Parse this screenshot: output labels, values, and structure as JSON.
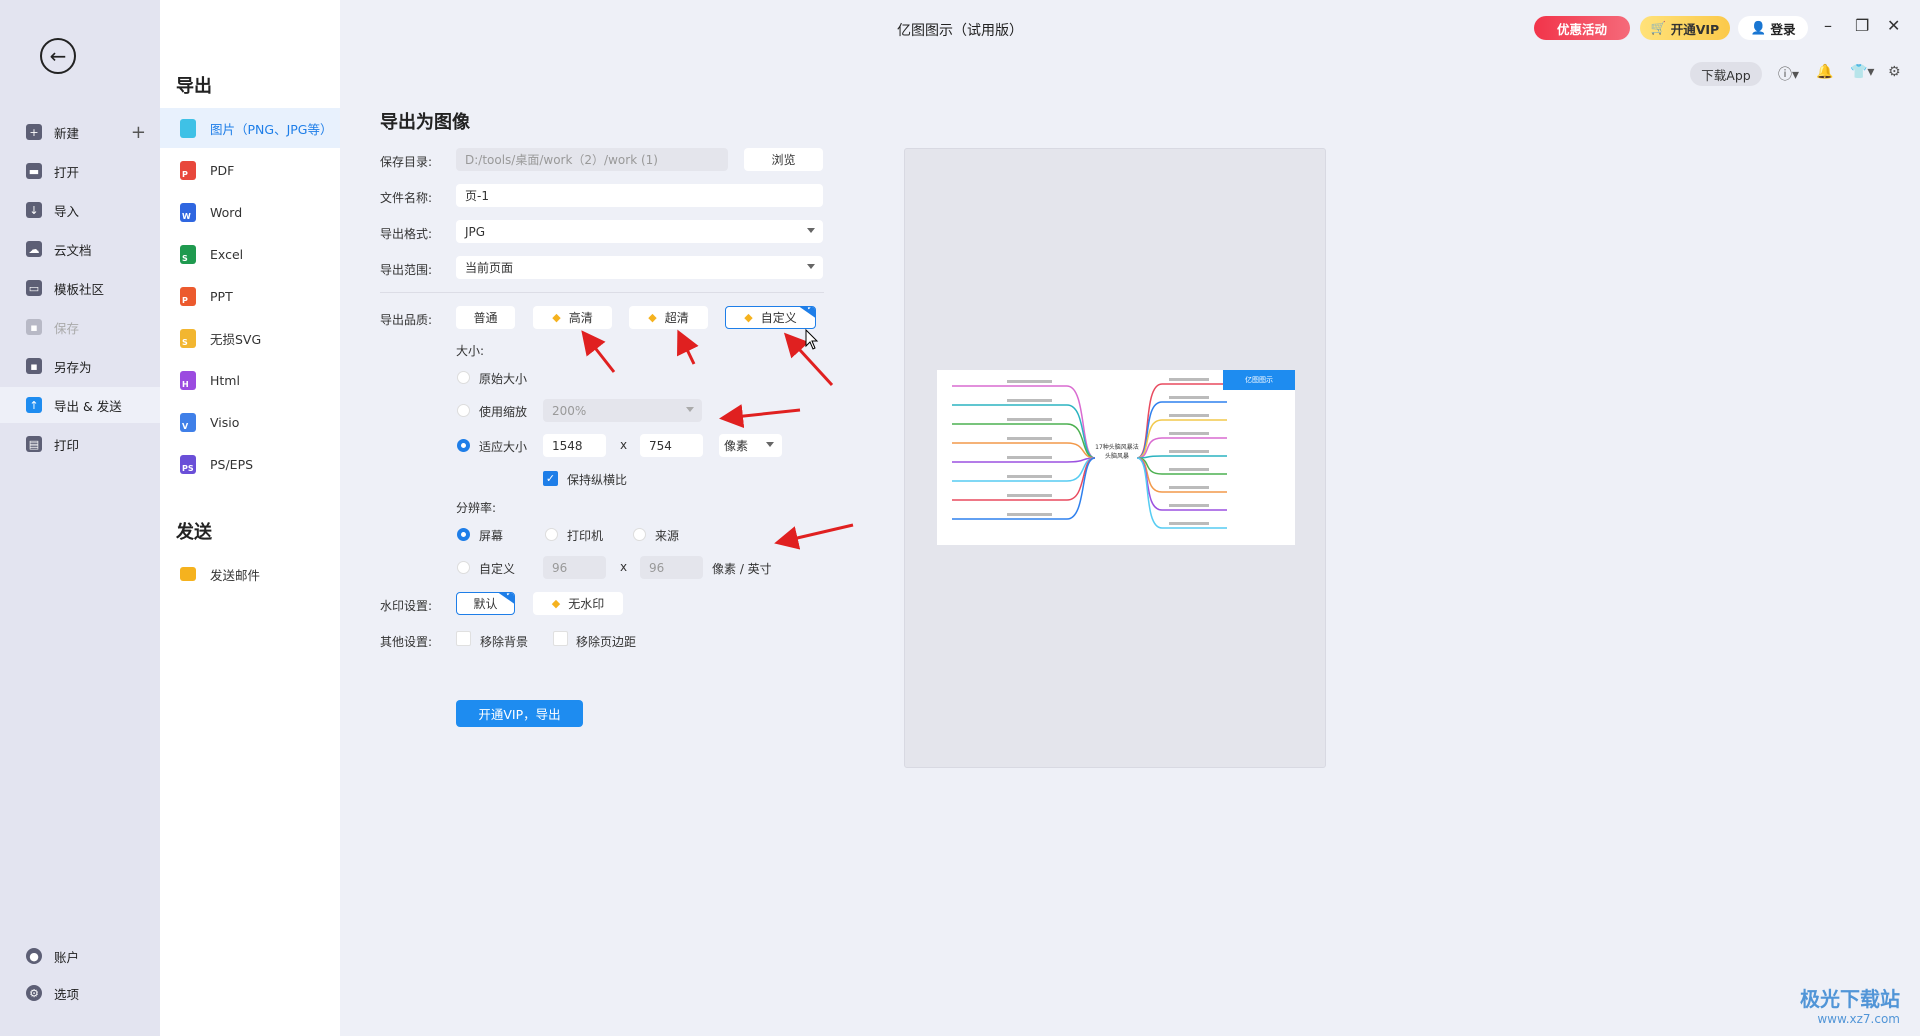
{
  "window": {
    "title": "亿图图示（试用版）",
    "promo": "优惠活动",
    "vip": "开通VIP",
    "login": "登录",
    "download_app": "下载App"
  },
  "sidebar": {
    "items": [
      {
        "label": "新建",
        "icon": "plus-square-icon"
      },
      {
        "label": "打开",
        "icon": "folder-icon"
      },
      {
        "label": "导入",
        "icon": "import-icon"
      },
      {
        "label": "云文档",
        "icon": "cloud-icon"
      },
      {
        "label": "模板社区",
        "icon": "community-icon"
      },
      {
        "label": "保存",
        "icon": "save-icon",
        "disabled": true
      },
      {
        "label": "另存为",
        "icon": "save-as-icon"
      },
      {
        "label": "导出 & 发送",
        "icon": "export-icon",
        "active": true
      },
      {
        "label": "打印",
        "icon": "print-icon"
      }
    ],
    "bottom": [
      {
        "label": "账户",
        "icon": "account-icon"
      },
      {
        "label": "选项",
        "icon": "gear-icon"
      }
    ]
  },
  "export_panel": {
    "export_heading": "导出",
    "send_heading": "发送",
    "formats": [
      {
        "label": "图片（PNG、JPG等）",
        "color": "#3fc1e6",
        "letter": ""
      },
      {
        "label": "PDF",
        "color": "#e8473c",
        "letter": "P"
      },
      {
        "label": "Word",
        "color": "#2f66e0",
        "letter": "W"
      },
      {
        "label": "Excel",
        "color": "#1f9a4f",
        "letter": "S"
      },
      {
        "label": "PPT",
        "color": "#ec5a2e",
        "letter": "P"
      },
      {
        "label": "无损SVG",
        "color": "#f2b630",
        "letter": "S"
      },
      {
        "label": "Html",
        "color": "#9b4be0",
        "letter": "H"
      },
      {
        "label": "Visio",
        "color": "#3f7fe8",
        "letter": "V"
      },
      {
        "label": "PS/EPS",
        "color": "#6a4fd8",
        "letter": "PS"
      }
    ],
    "send": [
      {
        "label": "发送邮件",
        "color": "#f5b21e"
      }
    ]
  },
  "form": {
    "title": "导出为图像",
    "save_dir_label": "保存目录:",
    "save_dir": "D:/tools/桌面/work（2）/work (1)",
    "browse": "浏览",
    "filename_label": "文件名称:",
    "filename": "页-1",
    "format_label": "导出格式:",
    "format": "JPG",
    "range_label": "导出范围:",
    "range": "当前页面",
    "quality_label": "导出品质:",
    "quality_options": [
      "普通",
      "高清",
      "超清",
      "自定义"
    ],
    "quality_selected": "自定义",
    "size_label": "大小:",
    "size_original": "原始大小",
    "size_scale": "使用缩放",
    "scale_value": "200%",
    "size_fit": "适应大小",
    "width": "1548",
    "x": "x",
    "height": "754",
    "unit": "像素",
    "keep_ratio": "保持纵横比",
    "keep_ratio_checked": true,
    "size_selected": "适应大小",
    "resolution_label": "分辨率:",
    "res_screen": "屏幕",
    "res_printer": "打印机",
    "res_source": "来源",
    "res_custom": "自定义",
    "dpi_x": "96",
    "dpi_y": "96",
    "dpi_unit": "像素 / 英寸",
    "res_selected": "屏幕",
    "watermark_label": "水印设置:",
    "watermark_default": "默认",
    "watermark_none": "无水印",
    "other_label": "其他设置:",
    "remove_bg": "移除背景",
    "remove_margin": "移除页边距",
    "export_button": "开通VIP，导出"
  },
  "preview": {
    "center_topic": "17种头脑风暴法 头脑风暴",
    "brand": "亿图图示"
  },
  "watermark_logo": {
    "text": "极光下载站",
    "url_text": "www.xz7.com"
  },
  "colors": {
    "accent": "#1e8cf0",
    "annotation": "#e02020"
  }
}
